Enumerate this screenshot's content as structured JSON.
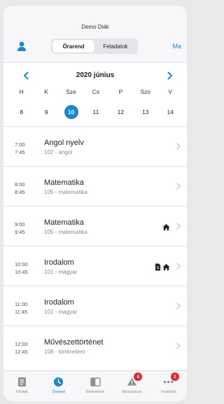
{
  "header": {
    "title": "Demo Diák",
    "segments": [
      "Órarend",
      "Feladatok"
    ],
    "active_segment": 0,
    "right_link": "Ma"
  },
  "calendar": {
    "month_label": "2020 június",
    "weekdays": [
      "H",
      "K",
      "Sze",
      "Cs",
      "P",
      "Szo",
      "V"
    ],
    "days": [
      "8",
      "9",
      "10",
      "11",
      "12",
      "13",
      "14"
    ],
    "selected_index": 2
  },
  "lessons": [
    {
      "start": "7:00",
      "end": "7:45",
      "subject": "Angol nyelv",
      "room": "102 - angol",
      "icons": []
    },
    {
      "start": "8:00",
      "end": "8:45",
      "subject": "Matematika",
      "room": "105 - matematika",
      "icons": []
    },
    {
      "start": "9:00",
      "end": "9:45",
      "subject": "Matematika",
      "room": "105 - matematika",
      "icons": [
        "home-icon"
      ]
    },
    {
      "start": "10:00",
      "end": "10:45",
      "subject": "Irodalom",
      "room": "101 - magyar",
      "icons": [
        "document-icon",
        "home-icon"
      ]
    },
    {
      "start": "11:00",
      "end": "11:45",
      "subject": "Irodalom",
      "room": "101 - magyar",
      "icons": []
    },
    {
      "start": "12:00",
      "end": "12:45",
      "subject": "Művészettörténet",
      "room": "108 - történelem",
      "icons": []
    }
  ],
  "tabbar": {
    "tabs": [
      {
        "label": "Főoldal",
        "icon": "home-doc-icon"
      },
      {
        "label": "Órarend",
        "icon": "clock-icon"
      },
      {
        "label": "Értékelések",
        "icon": "grades-icon"
      },
      {
        "label": "Mulasztások",
        "icon": "warning-icon",
        "badge": "6"
      },
      {
        "label": "Továbbiak",
        "icon": "more-icon",
        "badge": "2"
      }
    ],
    "active_index": 1
  },
  "colors": {
    "accent": "#1a87d4",
    "badge": "#e3262f"
  }
}
